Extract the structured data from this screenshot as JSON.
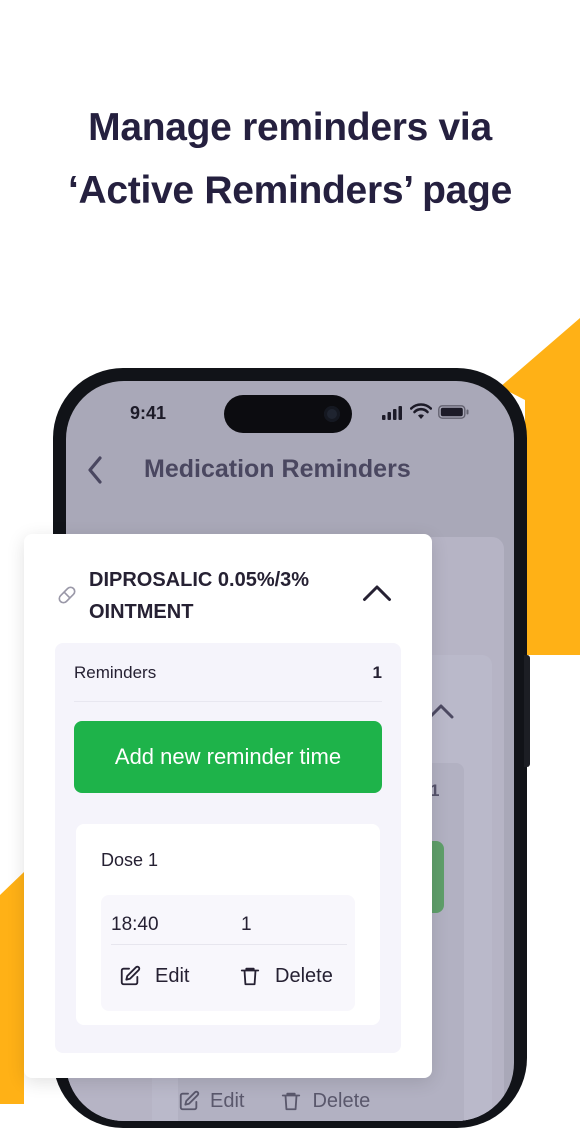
{
  "headline": {
    "line1": "Manage reminders via",
    "line2": "‘Active Reminders’ page"
  },
  "colors": {
    "accent_yellow": "#FFB116",
    "primary_green": "#1EB34A",
    "text_dark": "#25203F"
  },
  "status_bar": {
    "time": "9:41",
    "icons": [
      "signal-icon",
      "wifi-icon",
      "battery-icon"
    ]
  },
  "nav": {
    "back_icon": "chevron-left-icon",
    "title": "Medication Reminders"
  },
  "background_card": {
    "reminder_count": "1",
    "edit_label": "Edit",
    "delete_label": "Delete"
  },
  "medication": {
    "icon": "pill-icon",
    "name": "DIPROSALIC 0.05%/3% OINTMENT",
    "expanded": true,
    "reminders_label": "Reminders",
    "reminders_count": "1",
    "add_button_label": "Add new reminder time",
    "doses": [
      {
        "title": "Dose 1",
        "time": "18:40",
        "quantity": "1",
        "edit_label": "Edit",
        "delete_label": "Delete"
      }
    ]
  }
}
